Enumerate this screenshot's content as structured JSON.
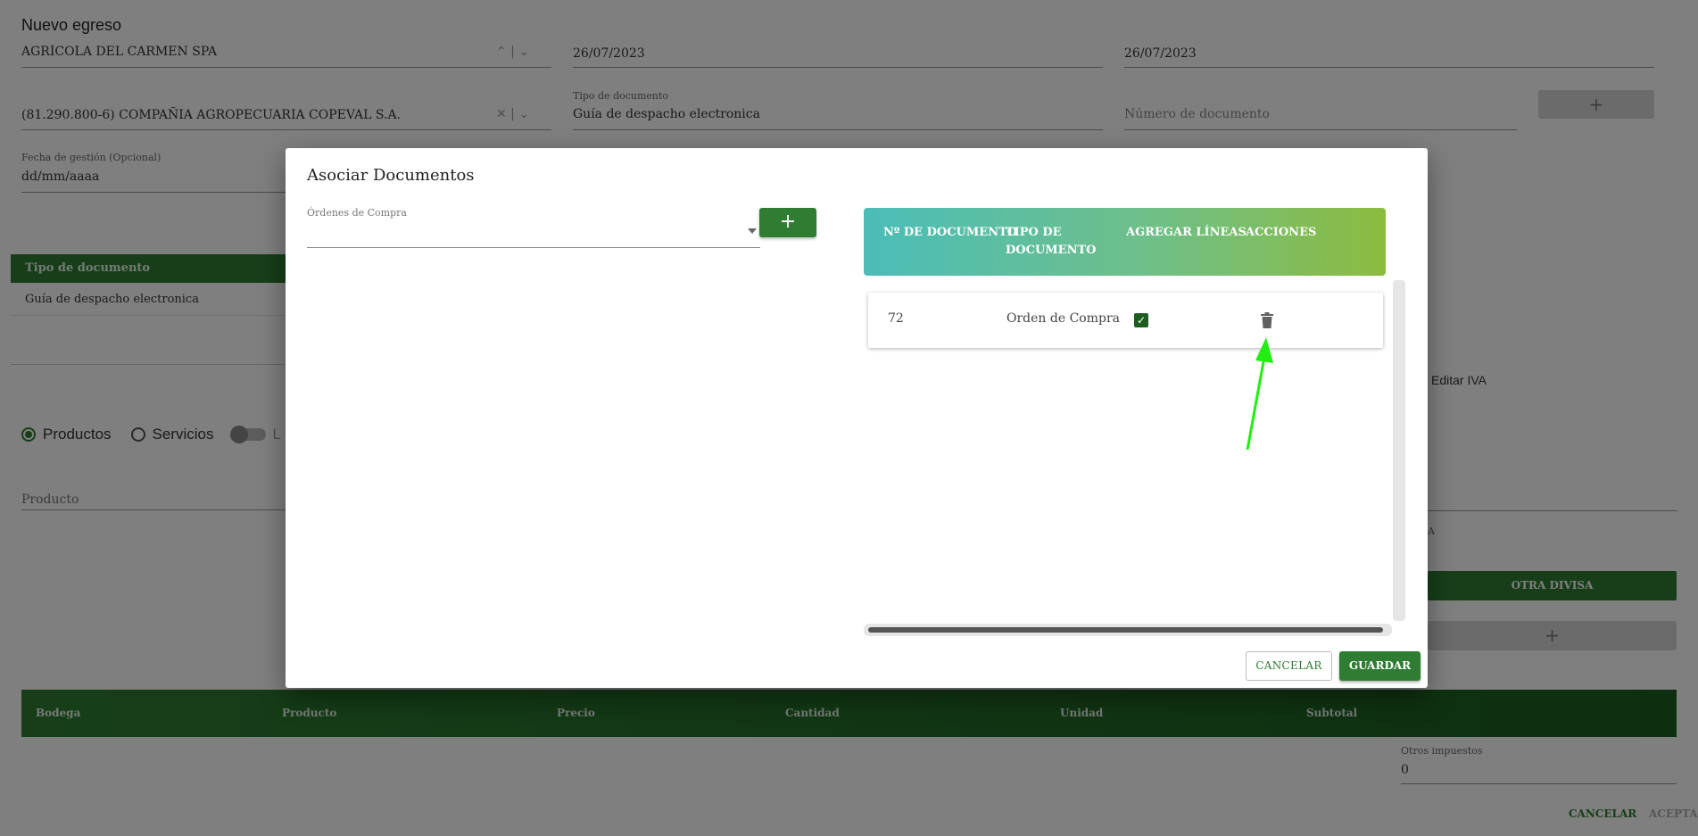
{
  "page": {
    "title": "Nuevo egreso",
    "client_value": "AGRÍCOLA DEL CARMEN SPA",
    "date1": "26/07/2023",
    "date2": "26/07/2023",
    "supplier_value": "(81.290.800-6) COMPAÑIA AGROPECUARIA COPEVAL S.A.",
    "doc_type_label": "Tipo de documento",
    "doc_type_value": "Guía de despacho electronica",
    "doc_number_placeholder": "Número de documento",
    "add_symbol": "+",
    "mgmt_date_label": "Fecha de gestión (Opcional)",
    "mgmt_date_value": "dd/mm/aaaa",
    "left_table_header": "Tipo de documento",
    "left_table_value": "Guía de despacho electronica",
    "edit_iva_label": "Editar IVA",
    "radio_products": "Productos",
    "radio_services": "Servicios",
    "toggle_letter": "L",
    "product_label": "Producto",
    "fragment_a": "A",
    "other_currency_button": "OTRA DIVISA",
    "lines_columns": [
      "Bodega",
      "Producto",
      "Precio",
      "Cantidad",
      "Unidad",
      "Subtotal"
    ],
    "other_taxes_label": "Otros impuestos",
    "other_taxes_value": "0",
    "cancel": "CANCELAR",
    "accept": "ACEPTAR"
  },
  "modal": {
    "title": "Asociar Documentos",
    "purchase_orders_label": "Órdenes de Compra",
    "add_symbol": "+",
    "table": {
      "col_doc_number": "Nº DE DOCUMENTO",
      "col_doc_type_line1": "TIPO DE",
      "col_doc_type_line2": "DOCUMENTO",
      "col_add_lines": "AGREGAR LÍNEAS",
      "col_actions": "ACCIONES",
      "rows": [
        {
          "doc_number": "72",
          "doc_type": "Orden de Compra",
          "add_lines": true
        }
      ]
    },
    "cancel_label": "CANCELAR",
    "save_label": "GUARDAR"
  },
  "colors": {
    "brand_green": "#2e7d32",
    "arrow": "#22ee11",
    "gradient_start": "#4bbdb8",
    "gradient_end": "#8dbb3f"
  },
  "icons": {
    "add": "plus-icon",
    "caret": "caret-down-icon",
    "checkbox": "check-icon",
    "delete": "trash-icon",
    "annotation": "arrow-icon"
  }
}
